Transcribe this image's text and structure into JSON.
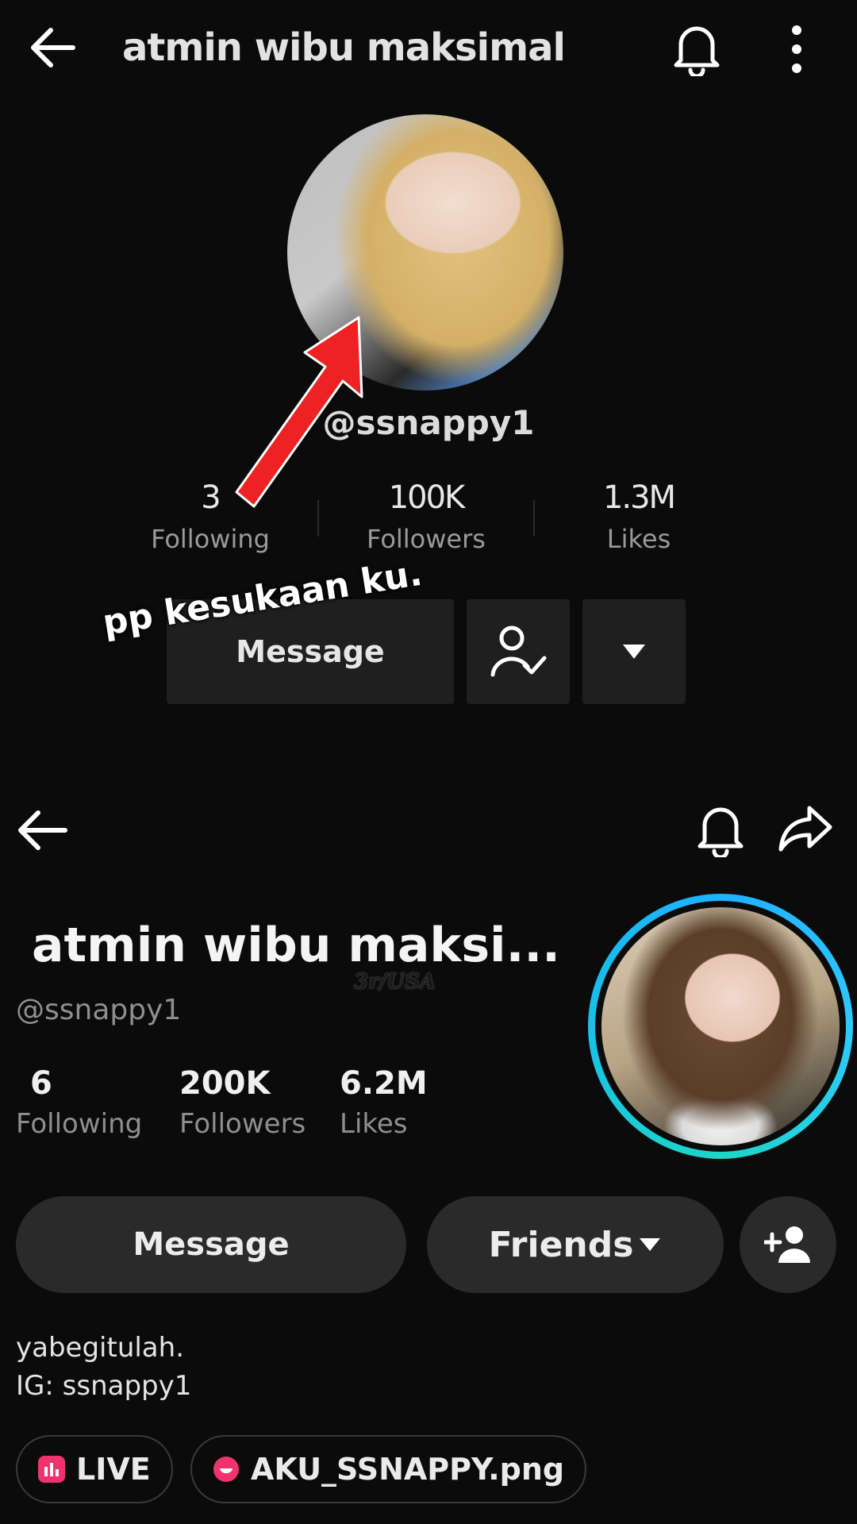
{
  "top_profile": {
    "title": "atmin wibu maksimal",
    "handle": "@ssnappy1",
    "stats": [
      {
        "value": "3",
        "label": "Following"
      },
      {
        "value": "100K",
        "label": "Followers"
      },
      {
        "value": "1.3M",
        "label": "Likes"
      }
    ],
    "message_label": "Message",
    "icons": [
      "back-arrow-icon",
      "bell-icon",
      "more-vertical-icon",
      "person-check-icon",
      "caret-down-icon"
    ]
  },
  "annotation": {
    "caption": "pp kesukaan ku.",
    "arrow_color": "#ee2222"
  },
  "bottom_profile": {
    "title": "atmin wibu maksi...",
    "watermark": "3r/USA",
    "handle": "@ssnappy1",
    "stats": [
      {
        "value": "6",
        "label": "Following"
      },
      {
        "value": "200K",
        "label": "Followers"
      },
      {
        "value": "6.2M",
        "label": "Likes"
      }
    ],
    "message_label": "Message",
    "friends_label": "Friends",
    "bio": [
      "yabegitulah.",
      "IG: ssnappy1"
    ],
    "chips": [
      {
        "label": "LIVE",
        "icon": "live-chart-icon"
      },
      {
        "label": "AKU_SSNAPPY.png",
        "icon": "bubble-icon"
      }
    ],
    "story_ring_colors": [
      "#1fb0ff",
      "#1dd6c6"
    ],
    "icons": [
      "back-arrow-icon",
      "bell-icon",
      "share-icon",
      "add-friend-icon"
    ]
  }
}
